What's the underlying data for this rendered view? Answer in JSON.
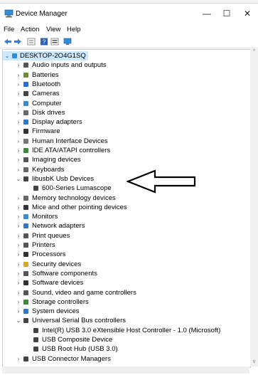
{
  "window": {
    "title": "Device Manager",
    "minimize": "—",
    "maximize": "☐",
    "close": "✕"
  },
  "menu": [
    "File",
    "Action",
    "View",
    "Help"
  ],
  "toolbar_icons": [
    "back-icon",
    "forward-icon",
    "properties-icon",
    "help-icon",
    "show-hidden-icon",
    "monitor-icon"
  ],
  "tree": {
    "root": "DESKTOP-2O4G1SQ",
    "items": [
      {
        "label": "Audio inputs and outputs",
        "icon": "speaker-icon",
        "expanded": false,
        "color": "#555555"
      },
      {
        "label": "Batteries",
        "icon": "battery-icon",
        "expanded": false,
        "color": "#6a8f2a"
      },
      {
        "label": "Bluetooth",
        "icon": "bluetooth-icon",
        "expanded": false,
        "color": "#1e6fd9"
      },
      {
        "label": "Cameras",
        "icon": "camera-icon",
        "expanded": false,
        "color": "#444444"
      },
      {
        "label": "Computer",
        "icon": "computer-icon",
        "expanded": false,
        "color": "#2f8fd8"
      },
      {
        "label": "Disk drives",
        "icon": "disk-icon",
        "expanded": false,
        "color": "#666666"
      },
      {
        "label": "Display adapters",
        "icon": "display-adapter-icon",
        "expanded": false,
        "color": "#2a7ac8"
      },
      {
        "label": "Firmware",
        "icon": "firmware-icon",
        "expanded": false,
        "color": "#333333"
      },
      {
        "label": "Human Interface Devices",
        "icon": "hid-icon",
        "expanded": false,
        "color": "#777777"
      },
      {
        "label": "IDE ATA/ATAPI controllers",
        "icon": "ide-icon",
        "expanded": false,
        "color": "#3a8a3a"
      },
      {
        "label": "Imaging devices",
        "icon": "imaging-icon",
        "expanded": false,
        "color": "#555555"
      },
      {
        "label": "Keyboards",
        "icon": "keyboard-icon",
        "expanded": false,
        "color": "#666666"
      },
      {
        "label": "libusbK Usb Devices",
        "icon": "usb-icon",
        "expanded": true,
        "color": "#444444"
      },
      {
        "label": "600-Series Lumascope",
        "icon": "usb-icon",
        "child": true,
        "color": "#444444"
      },
      {
        "label": "Memory technology devices",
        "icon": "memory-icon",
        "expanded": false,
        "color": "#666666"
      },
      {
        "label": "Mice and other pointing devices",
        "icon": "mouse-icon",
        "expanded": false,
        "color": "#333333"
      },
      {
        "label": "Monitors",
        "icon": "monitor-icon",
        "expanded": false,
        "color": "#2f8fd8"
      },
      {
        "label": "Network adapters",
        "icon": "network-icon",
        "expanded": false,
        "color": "#2a7ac8"
      },
      {
        "label": "Print queues",
        "icon": "print-queue-icon",
        "expanded": false,
        "color": "#555555"
      },
      {
        "label": "Printers",
        "icon": "printer-icon",
        "expanded": false,
        "color": "#555555"
      },
      {
        "label": "Processors",
        "icon": "processor-icon",
        "expanded": false,
        "color": "#333333"
      },
      {
        "label": "Security devices",
        "icon": "security-icon",
        "expanded": false,
        "color": "#d9a520"
      },
      {
        "label": "Software components",
        "icon": "software-component-icon",
        "expanded": false,
        "color": "#555555"
      },
      {
        "label": "Software devices",
        "icon": "software-device-icon",
        "expanded": false,
        "color": "#333333"
      },
      {
        "label": "Sound, video and game controllers",
        "icon": "sound-icon",
        "expanded": false,
        "color": "#555555"
      },
      {
        "label": "Storage controllers",
        "icon": "storage-icon",
        "expanded": false,
        "color": "#3a8a3a"
      },
      {
        "label": "System devices",
        "icon": "system-icon",
        "expanded": false,
        "color": "#2a7ac8"
      },
      {
        "label": "Universal Serial Bus controllers",
        "icon": "usb-icon",
        "expanded": true,
        "color": "#444444"
      },
      {
        "label": "Intel(R) USB 3.0 eXtensible Host Controller - 1.0 (Microsoft)",
        "icon": "usb-icon",
        "child": true,
        "color": "#444444"
      },
      {
        "label": "USB Composite Device",
        "icon": "usb-icon",
        "child": true,
        "color": "#444444"
      },
      {
        "label": "USB Root Hub (USB 3.0)",
        "icon": "usb-icon",
        "child": true,
        "color": "#444444"
      },
      {
        "label": "USB Connector Managers",
        "icon": "usb-icon",
        "expanded": false,
        "color": "#444444"
      }
    ]
  }
}
